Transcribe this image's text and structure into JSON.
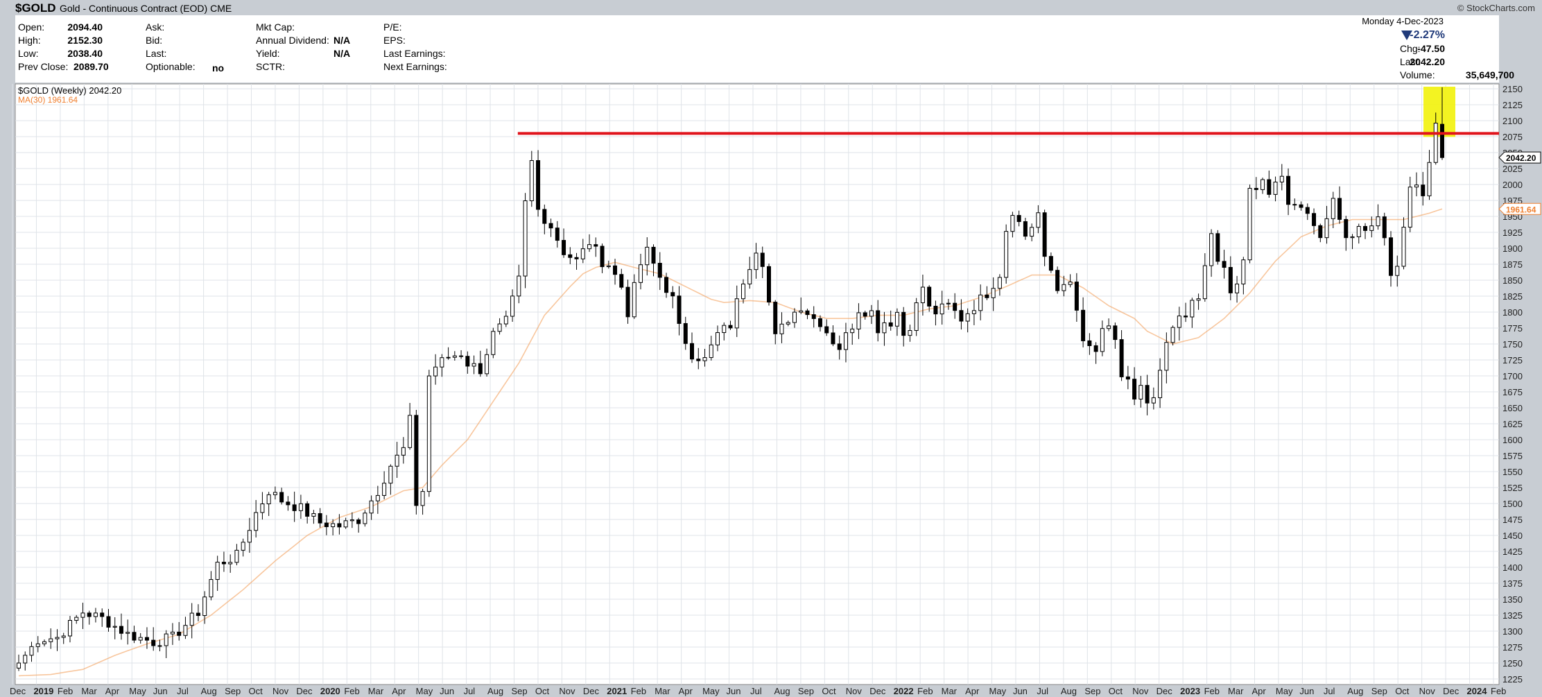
{
  "header": {
    "symbol": "$GOLD",
    "description": "Gold - Continuous Contract (EOD) CME",
    "watermark": "© StockCharts.com"
  },
  "quote": {
    "open_label": "Open:",
    "open": "2094.40",
    "high_label": "High:",
    "high": "2152.30",
    "low_label": "Low:",
    "low": "2038.40",
    "prev_close_label": "Prev Close:",
    "prev_close": "2089.70",
    "ask_label": "Ask:",
    "bid_label": "Bid:",
    "last_label_mid": "Last:",
    "optionable_label": "Optionable:",
    "optionable": "no",
    "mktcap_label": "Mkt Cap:",
    "annual_div_label": "Annual Dividend:",
    "annual_div": "N/A",
    "yield_label": "Yield:",
    "yield": "N/A",
    "sctr_label": "SCTR:",
    "pe_label": "P/E:",
    "eps_label": "EPS:",
    "last_earnings_label": "Last Earnings:",
    "next_earnings_label": "Next Earnings:",
    "date": "Monday  4-Dec-2023",
    "pct_change": "-2.27%",
    "chg_label": "Chg:",
    "chg": "-47.50",
    "last_label": "Last:",
    "last": "2042.20",
    "volume_label": "Volume:",
    "volume": "35,649,700"
  },
  "legend": {
    "series_label": "$GOLD (Weekly) 2042.20",
    "ma_label": "MA(30) 1961.64"
  },
  "colors": {
    "price": "#000000",
    "ma": "#f4a05c",
    "resistance": "#e0141c",
    "highlight": "#f2f20a",
    "down_arrow": "#203a7a",
    "pct_text": "#203a7a"
  },
  "chart_data": {
    "type": "candlestick",
    "title": "$GOLD (Weekly) 2042.20",
    "period": "weekly",
    "ylim": [
      1225,
      2150
    ],
    "yticks": [
      1225,
      1250,
      1275,
      1300,
      1325,
      1350,
      1375,
      1400,
      1425,
      1450,
      1475,
      1500,
      1525,
      1550,
      1575,
      1600,
      1625,
      1650,
      1675,
      1700,
      1725,
      1750,
      1775,
      1800,
      1825,
      1850,
      1875,
      1900,
      1925,
      1950,
      1975,
      2000,
      2025,
      2050,
      2075,
      2100,
      2125,
      2150
    ],
    "x_labels": [
      {
        "t": "Dec",
        "bold": false
      },
      {
        "t": "2019",
        "bold": true
      },
      {
        "t": "Feb",
        "bold": false
      },
      {
        "t": "Mar",
        "bold": false
      },
      {
        "t": "Apr",
        "bold": false
      },
      {
        "t": "May",
        "bold": false
      },
      {
        "t": "Jun",
        "bold": false
      },
      {
        "t": "Jul",
        "bold": false
      },
      {
        "t": "Aug",
        "bold": false
      },
      {
        "t": "Sep",
        "bold": false
      },
      {
        "t": "Oct",
        "bold": false
      },
      {
        "t": "Nov",
        "bold": false
      },
      {
        "t": "Dec",
        "bold": false
      },
      {
        "t": "2020",
        "bold": true
      },
      {
        "t": "Feb",
        "bold": false
      },
      {
        "t": "Mar",
        "bold": false
      },
      {
        "t": "Apr",
        "bold": false
      },
      {
        "t": "May",
        "bold": false
      },
      {
        "t": "Jun",
        "bold": false
      },
      {
        "t": "Jul",
        "bold": false
      },
      {
        "t": "Aug",
        "bold": false
      },
      {
        "t": "Sep",
        "bold": false
      },
      {
        "t": "Oct",
        "bold": false
      },
      {
        "t": "Nov",
        "bold": false
      },
      {
        "t": "Dec",
        "bold": false
      },
      {
        "t": "2021",
        "bold": true
      },
      {
        "t": "Feb",
        "bold": false
      },
      {
        "t": "Mar",
        "bold": false
      },
      {
        "t": "Apr",
        "bold": false
      },
      {
        "t": "May",
        "bold": false
      },
      {
        "t": "Jun",
        "bold": false
      },
      {
        "t": "Jul",
        "bold": false
      },
      {
        "t": "Aug",
        "bold": false
      },
      {
        "t": "Sep",
        "bold": false
      },
      {
        "t": "Oct",
        "bold": false
      },
      {
        "t": "Nov",
        "bold": false
      },
      {
        "t": "Dec",
        "bold": false
      },
      {
        "t": "2022",
        "bold": true
      },
      {
        "t": "Feb",
        "bold": false
      },
      {
        "t": "Mar",
        "bold": false
      },
      {
        "t": "Apr",
        "bold": false
      },
      {
        "t": "May",
        "bold": false
      },
      {
        "t": "Jun",
        "bold": false
      },
      {
        "t": "Jul",
        "bold": false
      },
      {
        "t": "Aug",
        "bold": false
      },
      {
        "t": "Sep",
        "bold": false
      },
      {
        "t": "Oct",
        "bold": false
      },
      {
        "t": "Nov",
        "bold": false
      },
      {
        "t": "Dec",
        "bold": false
      },
      {
        "t": "2023",
        "bold": true
      },
      {
        "t": "Feb",
        "bold": false
      },
      {
        "t": "Mar",
        "bold": false
      },
      {
        "t": "Apr",
        "bold": false
      },
      {
        "t": "May",
        "bold": false
      },
      {
        "t": "Jun",
        "bold": false
      },
      {
        "t": "Jul",
        "bold": false
      },
      {
        "t": "Aug",
        "bold": false
      },
      {
        "t": "Sep",
        "bold": false
      },
      {
        "t": "Oct",
        "bold": false
      },
      {
        "t": "Nov",
        "bold": false
      },
      {
        "t": "Dec",
        "bold": false
      },
      {
        "t": "2024",
        "bold": true
      },
      {
        "t": "Feb",
        "bold": false
      }
    ],
    "price_anchors": [
      [
        0,
        1250
      ],
      [
        3,
        1287
      ],
      [
        6,
        1290
      ],
      [
        10,
        1330
      ],
      [
        13,
        1320
      ],
      [
        17,
        1295
      ],
      [
        21,
        1283
      ],
      [
        24,
        1290
      ],
      [
        28,
        1330
      ],
      [
        31,
        1405
      ],
      [
        34,
        1418
      ],
      [
        37,
        1485
      ],
      [
        39,
        1520
      ],
      [
        41,
        1505
      ],
      [
        44,
        1492
      ],
      [
        47,
        1470
      ],
      [
        50,
        1465
      ],
      [
        53,
        1475
      ],
      [
        56,
        1520
      ],
      [
        58,
        1560
      ],
      [
        60,
        1585
      ],
      [
        61,
        1630
      ],
      [
        62,
        1500
      ],
      [
        63,
        1520
      ],
      [
        64,
        1700
      ],
      [
        65,
        1715
      ],
      [
        67,
        1730
      ],
      [
        69,
        1735
      ],
      [
        70,
        1720
      ],
      [
        72,
        1710
      ],
      [
        74,
        1765
      ],
      [
        76,
        1785
      ],
      [
        78,
        1850
      ],
      [
        79,
        1970
      ],
      [
        80,
        2035
      ],
      [
        81,
        1960
      ],
      [
        83,
        1935
      ],
      [
        85,
        1895
      ],
      [
        87,
        1880
      ],
      [
        89,
        1910
      ],
      [
        91,
        1880
      ],
      [
        92,
        1875
      ],
      [
        94,
        1840
      ],
      [
        95,
        1800
      ],
      [
        97,
        1875
      ],
      [
        98,
        1895
      ],
      [
        100,
        1855
      ],
      [
        102,
        1820
      ],
      [
        103,
        1775
      ],
      [
        105,
        1735
      ],
      [
        107,
        1725
      ],
      [
        109,
        1765
      ],
      [
        111,
        1780
      ],
      [
        113,
        1850
      ],
      [
        115,
        1900
      ],
      [
        116,
        1880
      ],
      [
        117,
        1815
      ],
      [
        118,
        1760
      ],
      [
        120,
        1790
      ],
      [
        122,
        1810
      ],
      [
        124,
        1790
      ],
      [
        125,
        1785
      ],
      [
        127,
        1755
      ],
      [
        128,
        1745
      ],
      [
        130,
        1780
      ],
      [
        131,
        1805
      ],
      [
        133,
        1800
      ],
      [
        134,
        1775
      ],
      [
        135,
        1785
      ],
      [
        136,
        1785
      ],
      [
        137,
        1800
      ],
      [
        138,
        1765
      ],
      [
        139,
        1780
      ],
      [
        141,
        1840
      ],
      [
        142,
        1805
      ],
      [
        143,
        1800
      ],
      [
        144,
        1805
      ],
      [
        145,
        1810
      ],
      [
        147,
        1790
      ],
      [
        148,
        1800
      ],
      [
        150,
        1820
      ],
      [
        151,
        1830
      ],
      [
        153,
        1860
      ],
      [
        154,
        1930
      ],
      [
        155,
        1960
      ],
      [
        156,
        1940
      ],
      [
        157,
        1920
      ],
      [
        158,
        1935
      ],
      [
        159,
        1955
      ],
      [
        160,
        1880
      ],
      [
        161,
        1865
      ],
      [
        162,
        1835
      ],
      [
        163,
        1850
      ],
      [
        164,
        1840
      ],
      [
        165,
        1800
      ],
      [
        166,
        1755
      ],
      [
        167,
        1740
      ],
      [
        168,
        1735
      ],
      [
        169,
        1775
      ],
      [
        170,
        1770
      ],
      [
        171,
        1750
      ],
      [
        172,
        1700
      ],
      [
        173,
        1695
      ],
      [
        174,
        1660
      ],
      [
        175,
        1680
      ],
      [
        176,
        1650
      ],
      [
        177,
        1665
      ],
      [
        178,
        1700
      ],
      [
        179,
        1750
      ],
      [
        180,
        1770
      ],
      [
        181,
        1795
      ],
      [
        182,
        1800
      ],
      [
        183,
        1810
      ],
      [
        184,
        1820
      ],
      [
        185,
        1870
      ],
      [
        186,
        1925
      ],
      [
        187,
        1875
      ],
      [
        188,
        1865
      ],
      [
        189,
        1830
      ],
      [
        190,
        1845
      ],
      [
        191,
        1875
      ],
      [
        192,
        1990
      ],
      [
        193,
        2000
      ],
      [
        194,
        2010
      ],
      [
        195,
        1985
      ],
      [
        196,
        1995
      ],
      [
        197,
        2010
      ],
      [
        198,
        1975
      ],
      [
        199,
        1965
      ],
      [
        200,
        1970
      ],
      [
        201,
        1960
      ],
      [
        202,
        1935
      ],
      [
        203,
        1920
      ],
      [
        204,
        1955
      ],
      [
        205,
        1970
      ],
      [
        206,
        1945
      ],
      [
        207,
        1925
      ],
      [
        208,
        1920
      ],
      [
        209,
        1940
      ],
      [
        210,
        1925
      ],
      [
        211,
        1940
      ],
      [
        212,
        1945
      ],
      [
        213,
        1920
      ],
      [
        214,
        1850
      ],
      [
        215,
        1870
      ],
      [
        216,
        1935
      ],
      [
        217,
        1990
      ],
      [
        218,
        2005
      ],
      [
        219,
        1985
      ],
      [
        220,
        2036
      ],
      [
        221,
        2089
      ],
      [
        222,
        2042
      ]
    ],
    "ma30_anchors": [
      [
        0,
        1230
      ],
      [
        5,
        1232
      ],
      [
        10,
        1240
      ],
      [
        15,
        1262
      ],
      [
        20,
        1280
      ],
      [
        25,
        1295
      ],
      [
        30,
        1325
      ],
      [
        35,
        1365
      ],
      [
        40,
        1410
      ],
      [
        45,
        1450
      ],
      [
        50,
        1478
      ],
      [
        55,
        1495
      ],
      [
        60,
        1520
      ],
      [
        63,
        1525
      ],
      [
        66,
        1560
      ],
      [
        70,
        1600
      ],
      [
        74,
        1660
      ],
      [
        78,
        1720
      ],
      [
        82,
        1795
      ],
      [
        86,
        1840
      ],
      [
        88,
        1860
      ],
      [
        90,
        1870
      ],
      [
        93,
        1878
      ],
      [
        96,
        1870
      ],
      [
        100,
        1860
      ],
      [
        104,
        1840
      ],
      [
        108,
        1820
      ],
      [
        110,
        1815
      ],
      [
        114,
        1818
      ],
      [
        118,
        1815
      ],
      [
        122,
        1800
      ],
      [
        126,
        1790
      ],
      [
        130,
        1790
      ],
      [
        134,
        1795
      ],
      [
        138,
        1795
      ],
      [
        142,
        1805
      ],
      [
        146,
        1810
      ],
      [
        150,
        1823
      ],
      [
        154,
        1840
      ],
      [
        158,
        1858
      ],
      [
        162,
        1858
      ],
      [
        166,
        1838
      ],
      [
        170,
        1810
      ],
      [
        174,
        1790
      ],
      [
        176,
        1770
      ],
      [
        180,
        1750
      ],
      [
        184,
        1760
      ],
      [
        188,
        1790
      ],
      [
        192,
        1830
      ],
      [
        196,
        1880
      ],
      [
        200,
        1918
      ],
      [
        204,
        1935
      ],
      [
        208,
        1945
      ],
      [
        212,
        1945
      ],
      [
        216,
        1945
      ],
      [
        220,
        1955
      ],
      [
        222,
        1961.64
      ]
    ],
    "last_candle": {
      "open": 2094.4,
      "high": 2152.3,
      "low": 2038.4,
      "close": 2042.2
    },
    "annotations": {
      "resistance_level": 2080,
      "last_price_tag": "2042.20",
      "ma_price_tag": "1961.64"
    },
    "grid": true,
    "legend_position": "top-left"
  }
}
